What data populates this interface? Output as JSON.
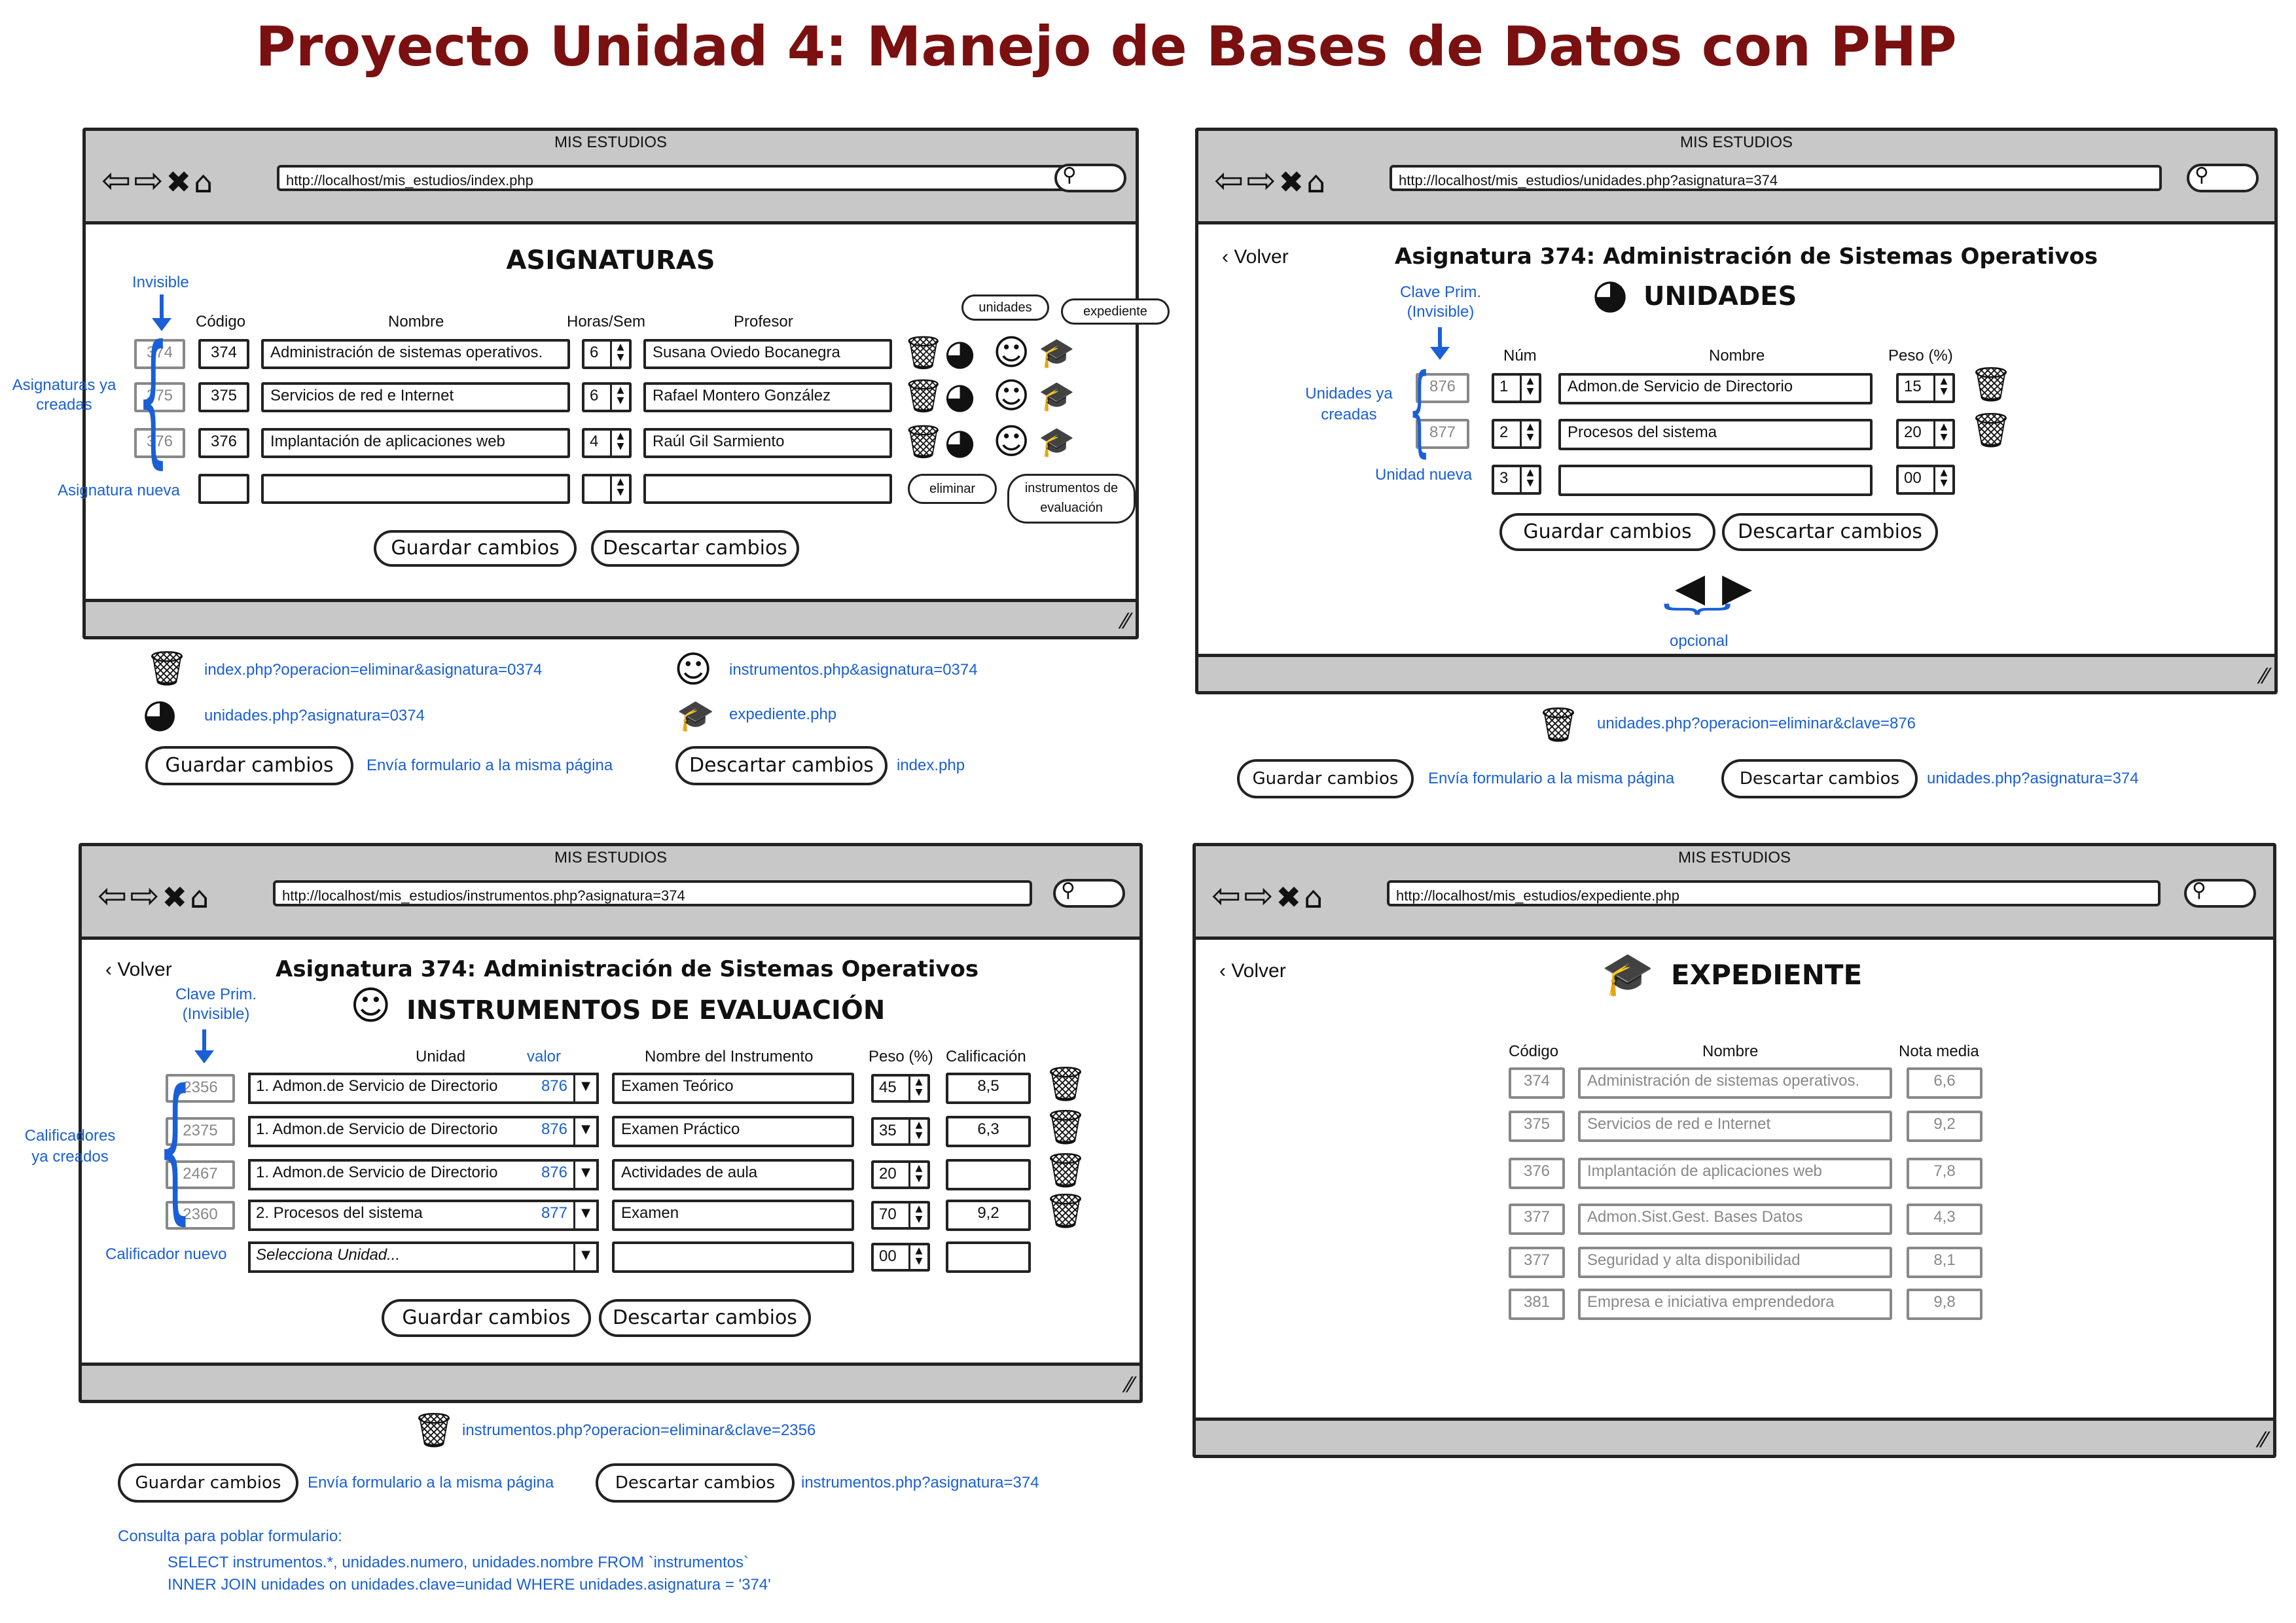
{
  "page_title": "Proyecto Unidad 4: Manejo de Bases de Datos con PHP",
  "colors": {
    "title": "#7a1010",
    "annotation": "#1a5fd6",
    "chrome": "#c8c8c8"
  },
  "icons": {
    "back": "arrow-left-icon",
    "forward": "arrow-right-icon",
    "stop": "close-icon",
    "home": "home-icon",
    "search": "search-icon",
    "delete": "trash-icon",
    "units": "pie-chart-icon",
    "instruments": "smiley-icon",
    "record": "graduation-cap-icon"
  },
  "common": {
    "window_title": "MIS ESTUDIOS",
    "save": "Guardar cambios",
    "discard": "Descartar cambios",
    "back": "‹ Volver"
  },
  "w1": {
    "url": "http://localhost/mis_estudios/index.php",
    "heading": "ASIGNATURAS",
    "note_invisible": "Invisible",
    "note_created": "Asignaturas ya creadas",
    "note_new": "Asignatura nueva",
    "headers": {
      "code": "Código",
      "name": "Nombre",
      "hours": "Horas/Sem",
      "teacher": "Profesor"
    },
    "rows": [
      {
        "id": "374",
        "code": "374",
        "name": "Administración de sistemas operativos.",
        "hours": "6",
        "teacher": "Susana Oviedo Bocanegra"
      },
      {
        "id": "375",
        "code": "375",
        "name": "Servicios de red e Internet",
        "hours": "6",
        "teacher": "Rafael Montero González"
      },
      {
        "id": "376",
        "code": "376",
        "name": "Implantación de aplicaciones web",
        "hours": "4",
        "teacher": "Raúl Gil Sarmiento"
      }
    ],
    "bubbles": {
      "units": "unidades",
      "record": "expediente",
      "delete": "eliminar",
      "instruments": "instrumentos de evaluación"
    },
    "legend": {
      "delete": "index.php?operacion=eliminar&asignatura=0374",
      "instruments": "instrumentos.php&asignatura=0374",
      "units": "unidades.php?asignatura=0374",
      "record": "expediente.php",
      "save": "Envía formulario a la misma página",
      "discard": "index.php"
    }
  },
  "w2": {
    "url": "http://localhost/mis_estudios/unidades.php?asignatura=374",
    "subject": "Asignatura 374: Administración de Sistemas Operativos",
    "heading": "UNIDADES",
    "note_pk": "Clave Prim. (Invisible)",
    "note_created": "Unidades ya creadas",
    "note_new": "Unidad nueva",
    "note_optional": "opcional",
    "headers": {
      "num": "Núm",
      "name": "Nombre",
      "weight": "Peso (%)"
    },
    "rows": [
      {
        "id": "876",
        "num": "1",
        "name": "Admon.de Servicio de Directorio",
        "weight": "15"
      },
      {
        "id": "877",
        "num": "2",
        "name": "Procesos del sistema",
        "weight": "20"
      }
    ],
    "new_row": {
      "num": "3",
      "weight": "00"
    },
    "legend": {
      "delete": "unidades.php?operacion=eliminar&clave=876",
      "save": "Envía formulario a la misma página",
      "discard": "unidades.php?asignatura=374"
    }
  },
  "w3": {
    "url": "http://localhost/mis_estudios/instrumentos.php?asignatura=374",
    "subject": "Asignatura 374: Administración de Sistemas Operativos",
    "heading": "INSTRUMENTOS DE EVALUACIÓN",
    "note_pk": "Clave Prim. (Invisible)",
    "note_created": "Calificadores ya creados",
    "note_new": "Calificador nuevo",
    "headers": {
      "unit": "Unidad",
      "value": "valor",
      "name": "Nombre del Instrumento",
      "weight": "Peso (%)",
      "grade": "Calificación"
    },
    "rows": [
      {
        "id": "2356",
        "unit": "1. Admon.de Servicio de Directorio",
        "value": "876",
        "name": "Examen Teórico",
        "weight": "45",
        "grade": "8,5"
      },
      {
        "id": "2375",
        "unit": "1. Admon.de Servicio de Directorio",
        "value": "876",
        "name": "Examen Práctico",
        "weight": "35",
        "grade": "6,3"
      },
      {
        "id": "2467",
        "unit": "1. Admon.de Servicio de Directorio",
        "value": "876",
        "name": "Actividades de aula",
        "weight": "20",
        "grade": ""
      },
      {
        "id": "2360",
        "unit": "2. Procesos del sistema",
        "value": "877",
        "name": "Examen",
        "weight": "70",
        "grade": "9,2"
      }
    ],
    "new_row": {
      "unit_placeholder": "Selecciona Unidad...",
      "weight": "00"
    },
    "legend": {
      "delete": "instrumentos.php?operacion=eliminar&clave=2356",
      "save": "Envía formulario a la misma página",
      "discard": "instrumentos.php?asignatura=374",
      "query_label": "Consulta para poblar formulario:",
      "query_line1": "SELECT instrumentos.*, unidades.numero,  unidades.nombre FROM `instrumentos`",
      "query_line2": "INNER JOIN unidades on unidades.clave=unidad WHERE unidades.asignatura = '374'"
    }
  },
  "w4": {
    "url": "http://localhost/mis_estudios/expediente.php",
    "heading": "EXPEDIENTE",
    "headers": {
      "code": "Código",
      "name": "Nombre",
      "avg": "Nota media"
    },
    "rows": [
      {
        "code": "374",
        "name": "Administración de sistemas operativos.",
        "avg": "6,6"
      },
      {
        "code": "375",
        "name": "Servicios de red e Internet",
        "avg": "9,2"
      },
      {
        "code": "376",
        "name": "Implantación de aplicaciones web",
        "avg": "7,8"
      },
      {
        "code": "377",
        "name": "Admon.Sist.Gest. Bases Datos",
        "avg": "4,3"
      },
      {
        "code": "377",
        "name": "Seguridad y alta disponibilidad",
        "avg": "8,1"
      },
      {
        "code": "381",
        "name": "Empresa e iniciativa emprendedora",
        "avg": "9,8"
      }
    ]
  }
}
